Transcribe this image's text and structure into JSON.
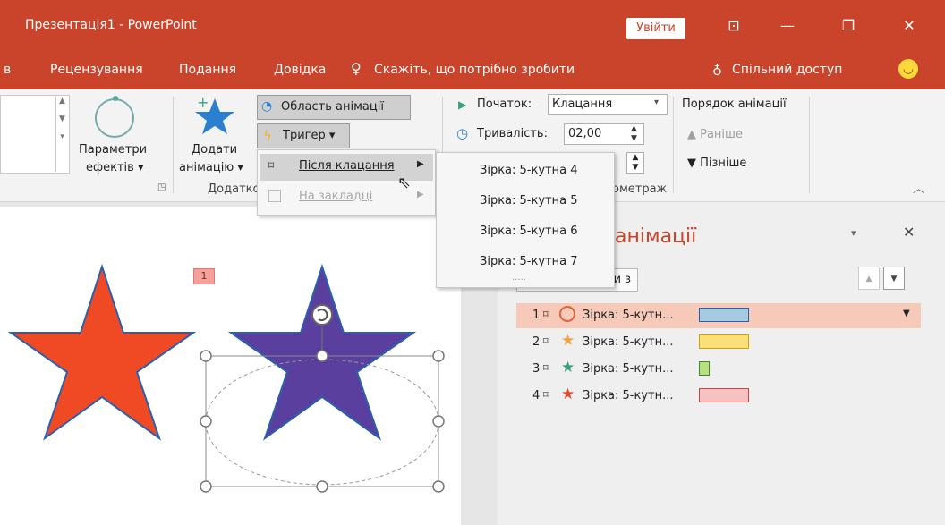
{
  "window": {
    "title": "Презентація1 - PowerPoint",
    "signin": "Увійти"
  },
  "menubar": {
    "partial_tab": "в",
    "tabs": [
      "Рецензування",
      "Подання",
      "Довідка"
    ],
    "tellme": "Скажіть, що потрібно зробити",
    "share": "Спільний доступ"
  },
  "ribbon": {
    "effect_options": [
      "Параметри",
      "ефектів ▾"
    ],
    "add_animation": [
      "Додати",
      "анімацію ▾"
    ],
    "group_partial": "Додатко",
    "animation_pane_btn": "Область анімації",
    "trigger_btn": "Тригер ▾",
    "start_label": "Початок:",
    "start_value": "Клацання",
    "duration_label": "Тривалість:",
    "duration_value": "02,00",
    "reorder_title": "Порядок анімації",
    "move_earlier": "▲ Раніше",
    "move_later": "▼ Пізніше",
    "timing_group_partial": "ометраж"
  },
  "trigger_menu": {
    "on_click": "Після клацання",
    "on_bookmark": "На закладці"
  },
  "submenu": {
    "items": [
      "Зірка: 5-кутна 4",
      "Зірка: 5-кутна 5",
      "Зірка: 5-кутна 6",
      "Зірка: 5-кутна 7"
    ],
    "grip": "....."
  },
  "slide": {
    "anim_tag": "1"
  },
  "pane": {
    "title_partial": "анімації",
    "play_partial": "ти з",
    "items": [
      {
        "num": "1",
        "label": "Зірка: 5-кутн...",
        "icon_color": "#e0633a",
        "bar_color": "#a7cbe0"
      },
      {
        "num": "2",
        "label": "Зірка: 5-кутн...",
        "icon_color": "#f2a23c",
        "bar_color": "#fbe07a"
      },
      {
        "num": "3",
        "label": "Зірка: 5-кутн...",
        "icon_color": "#3aa17e",
        "bar_color": "#b9e07f"
      },
      {
        "num": "4",
        "label": "Зірка: 5-кутн...",
        "icon_color": "#e04a2e",
        "bar_color": "#f5c1c1"
      }
    ]
  },
  "colors": {
    "accent": "#c9442a",
    "star_red": "#ef4a23",
    "star_purple": "#5b3f9e",
    "star_blue": "#2b7fd1"
  }
}
